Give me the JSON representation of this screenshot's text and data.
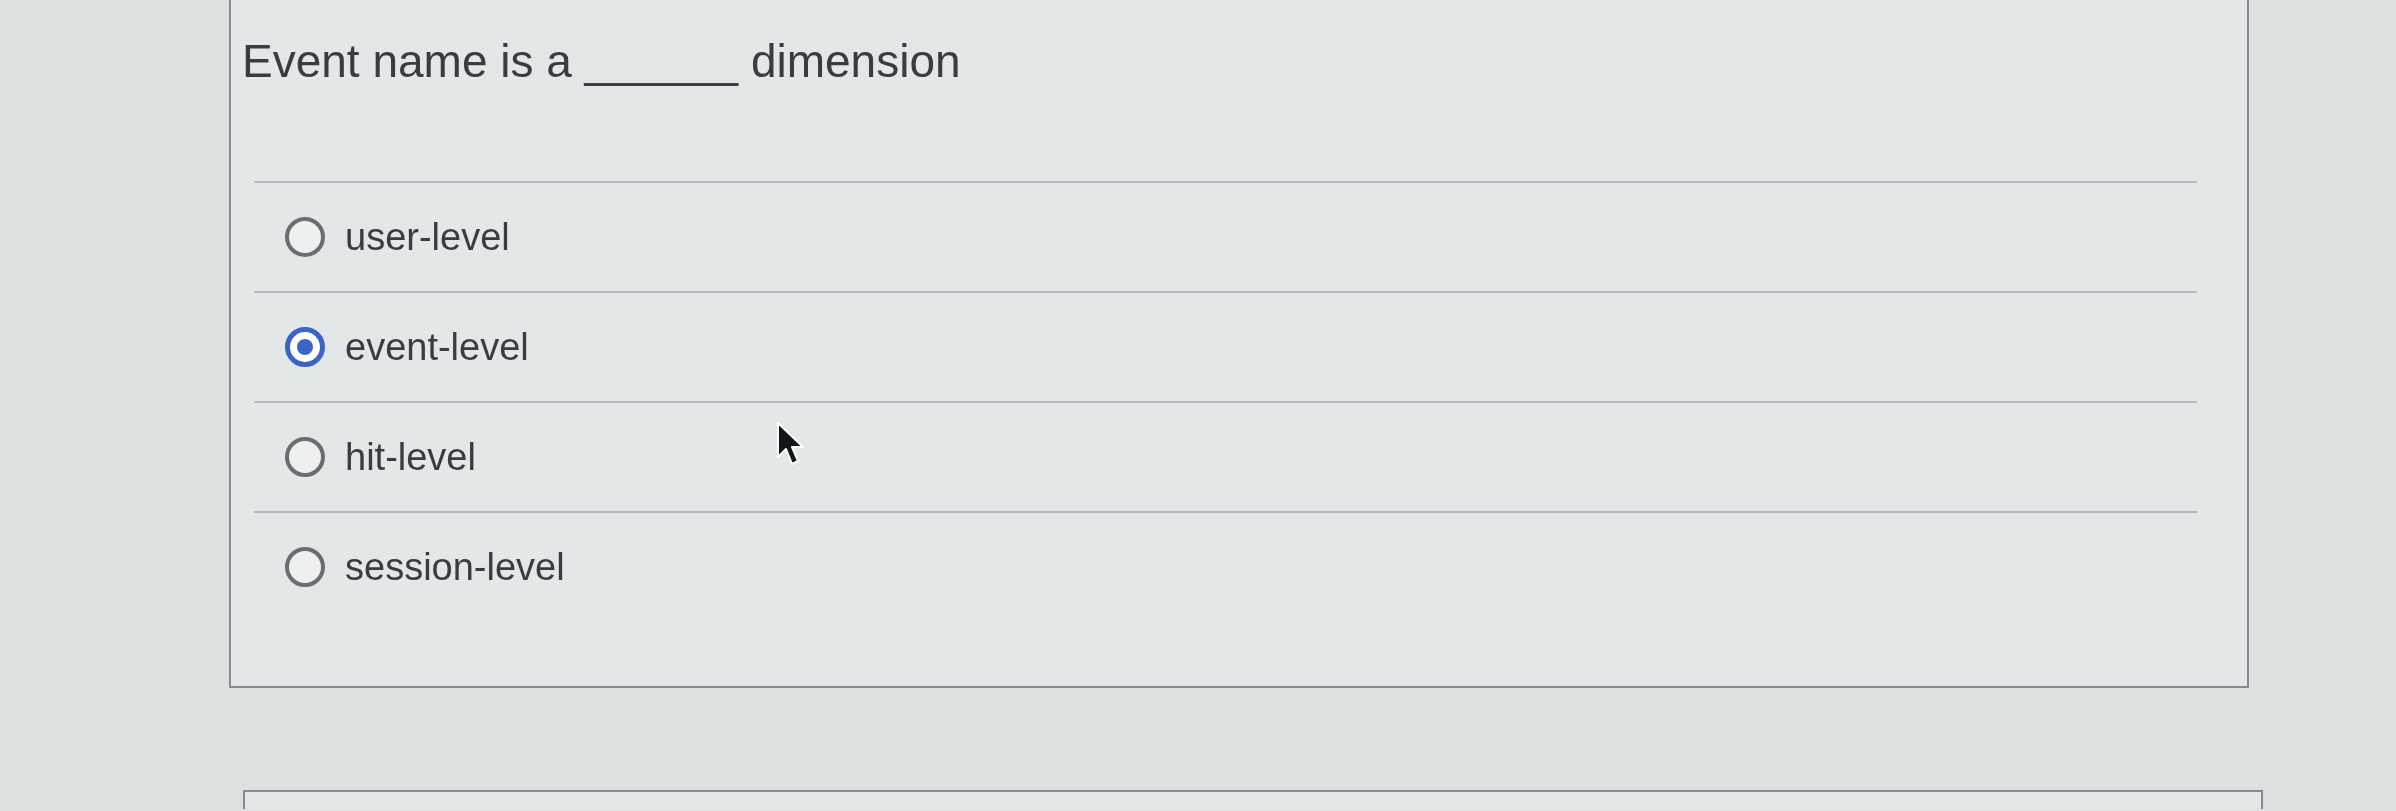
{
  "question": {
    "text": "Event name is a ______ dimension"
  },
  "options": [
    {
      "label": "user-level",
      "selected": false
    },
    {
      "label": "event-level",
      "selected": true
    },
    {
      "label": "hit-level",
      "selected": false
    },
    {
      "label": "session-level",
      "selected": false
    }
  ]
}
